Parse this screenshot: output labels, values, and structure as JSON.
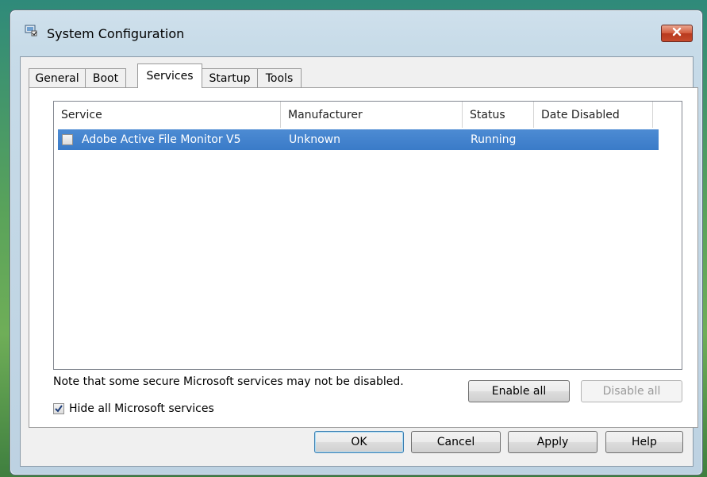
{
  "window": {
    "title": "System Configuration"
  },
  "tabs": [
    {
      "label": "General",
      "active": false
    },
    {
      "label": "Boot",
      "active": false
    },
    {
      "label": "Services",
      "active": true
    },
    {
      "label": "Startup",
      "active": false
    },
    {
      "label": "Tools",
      "active": false
    }
  ],
  "services": {
    "columns": [
      "Service",
      "Manufacturer",
      "Status",
      "Date Disabled"
    ],
    "rows": [
      {
        "checked": false,
        "service": "Adobe Active File Monitor V5",
        "manufacturer": "Unknown",
        "status": "Running",
        "date_disabled": "",
        "selected": true
      }
    ],
    "note": "Note that some secure Microsoft services may not be disabled.",
    "enable_all": "Enable all",
    "disable_all": "Disable all",
    "hide_ms_label": "Hide all Microsoft services",
    "hide_ms_checked": true
  },
  "footer": {
    "ok": "OK",
    "cancel": "Cancel",
    "apply": "Apply",
    "help": "Help"
  },
  "colors": {
    "selection": "#3a7bc8",
    "close_button": "#c64a2c"
  },
  "icons": {
    "app": "system-configuration-icon",
    "close": "close-icon",
    "check": "checkmark-icon"
  }
}
